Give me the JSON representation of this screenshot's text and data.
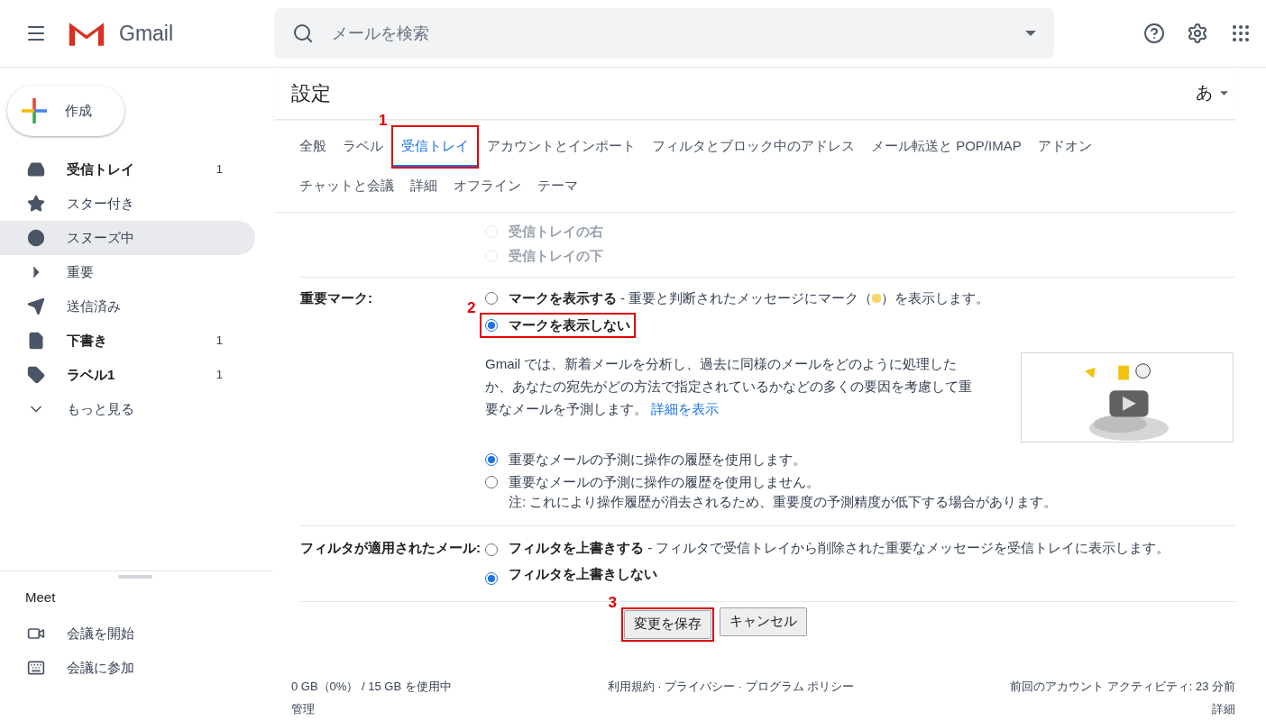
{
  "app": {
    "name": "Gmail"
  },
  "search": {
    "placeholder": "メールを検索"
  },
  "compose": {
    "label": "作成"
  },
  "nav": [
    {
      "label": "受信トレイ",
      "count": "1",
      "bold": true,
      "selected": false
    },
    {
      "label": "スター付き",
      "bold": false,
      "selected": false
    },
    {
      "label": "スヌーズ中",
      "bold": false,
      "selected": true
    },
    {
      "label": "重要",
      "bold": false,
      "selected": false
    },
    {
      "label": "送信済み",
      "bold": false,
      "selected": false
    },
    {
      "label": "下書き",
      "count": "1",
      "bold": true,
      "selected": false
    },
    {
      "label": "ラベル1",
      "count": "1",
      "bold": true,
      "selected": false
    },
    {
      "label": "もっと見る",
      "bold": false,
      "selected": false
    }
  ],
  "meet": {
    "title": "Meet",
    "items": [
      {
        "label": "会議を開始"
      },
      {
        "label": "会議に参加"
      }
    ]
  },
  "settings": {
    "title": "設定",
    "input_tool": "あ",
    "tabs": [
      {
        "label": "全般",
        "selected": false
      },
      {
        "label": "ラベル",
        "selected": false
      },
      {
        "label": "受信トレイ",
        "selected": true,
        "annotation": "1"
      },
      {
        "label": "アカウントとインポート",
        "selected": false
      },
      {
        "label": "フィルタとブロック中のアドレス",
        "selected": false
      },
      {
        "label": "メール転送と POP/IMAP",
        "selected": false
      },
      {
        "label": "アドオン",
        "selected": false
      },
      {
        "label": "チャットと会議",
        "selected": false
      },
      {
        "label": "詳細",
        "selected": false
      },
      {
        "label": "オフライン",
        "selected": false
      },
      {
        "label": "テーマ",
        "selected": false
      }
    ],
    "reading_pane_options": [
      {
        "label": "受信トレイの右",
        "selected": false,
        "disabled": true
      },
      {
        "label": "受信トレイの下",
        "selected": false,
        "disabled": true
      }
    ],
    "importance": {
      "label": "重要マーク:",
      "options": [
        {
          "label": "マークを表示する",
          "desc_before": "- 重要と判断されたメッセージにマーク（",
          "desc_after": "）を表示します。",
          "selected": false
        },
        {
          "label": "マークを表示しない",
          "selected": true,
          "annotation": "2"
        }
      ],
      "explanation": "Gmail では、新着メールを分析し、過去に同様のメールをどのように処理したか、あなたの宛先がどの方法で指定されているかなどの多くの要因を考慮して重要なメールを予測します。",
      "link": "詳細を表示",
      "history_options": [
        {
          "label": "重要なメールの予測に操作の履歴を使用します。",
          "selected": true
        },
        {
          "label": "重要なメールの予測に操作の履歴を使用しません。",
          "note": "注: これにより操作履歴が消去されるため、重要度の予測精度が低下する場合があります。",
          "selected": false
        }
      ]
    },
    "filtered": {
      "label": "フィルタが適用されたメール:",
      "options": [
        {
          "label": "フィルタを上書きする",
          "desc_before": "- フィルタで受信トレイから削除された重要なメッセージを受信トレイに表示します。",
          "selected": false
        },
        {
          "label": "フィルタを上書きしない",
          "selected": true
        }
      ]
    },
    "buttons": [
      {
        "label": "変更を保存",
        "annotation": "3"
      },
      {
        "label": "キャンセル"
      }
    ]
  },
  "footer": {
    "storage": "0 GB（0%） / 15 GB を使用中",
    "manage": "管理",
    "links": "利用規約 · プライバシー · プログラム ポリシー",
    "activity": "前回のアカウント アクティビティ: 23 分前",
    "details": "詳細"
  }
}
